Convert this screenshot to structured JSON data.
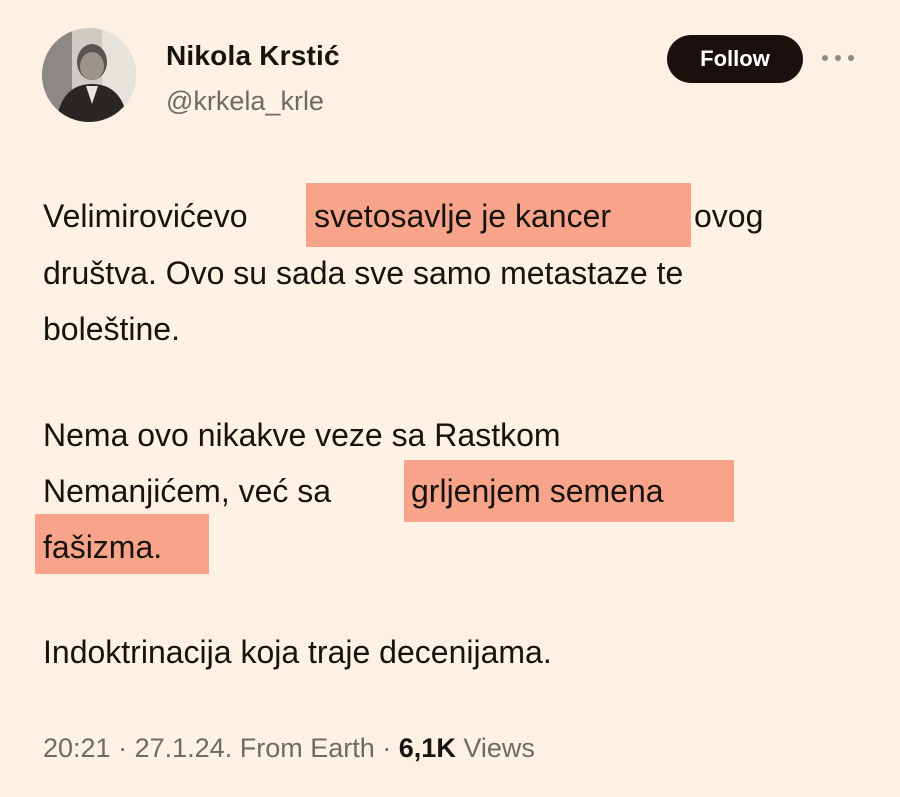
{
  "author": {
    "name": "Nikola Krstić",
    "handle": "@krkela_krle"
  },
  "actions": {
    "follow_label": "Follow",
    "more_icon": "more-horizontal-icon"
  },
  "tweet": {
    "lines": [
      "Velimirovićevo",
      "svetosavlje je kancer",
      "ovog",
      "društva. Ovo su sada sve samo metastaze te",
      "boleštine.",
      "Nema ovo nikakve veze sa Rastkom",
      "Nemanjićem, već sa",
      "grljenjem semena",
      "fašizma.",
      "Indoktrinacija koja traje decenijama."
    ]
  },
  "meta": {
    "time": "20:21",
    "date": "27.1.24.",
    "source": "From Earth",
    "views_count": "6,1K",
    "views_label": "Views",
    "separator": "·"
  },
  "colors": {
    "background": "#fcf1e2",
    "highlight": "#f7a48b",
    "button": "#1a100e"
  }
}
